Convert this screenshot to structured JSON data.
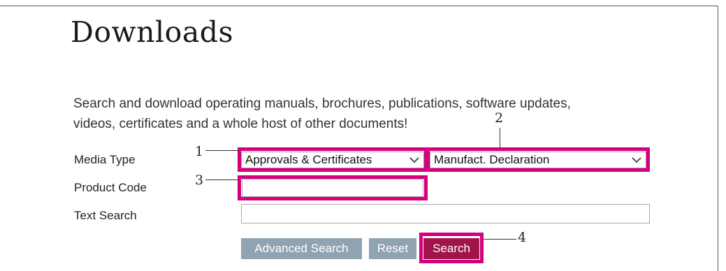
{
  "page": {
    "title": "Downloads"
  },
  "intro": {
    "line1": "Search and download operating manuals, brochures, publications, software updates,",
    "line2": "videos, certificates and a whole host of other documents!"
  },
  "form": {
    "media_type_label": "Media Type",
    "media_type_value": "Approvals & Certificates",
    "media_subtype_value": "Manufact. Declaration",
    "product_code_label": "Product Code",
    "product_code_value": "",
    "text_search_label": "Text Search",
    "text_search_value": ""
  },
  "buttons": {
    "advanced_search": "Advanced Search",
    "reset": "Reset",
    "search": "Search"
  },
  "callouts": {
    "c1": "1",
    "c2": "2",
    "c3": "3",
    "c4": "4"
  },
  "colors": {
    "highlight": "#d6007e",
    "search_button": "#a0144a",
    "grey_button": "#8fa3b0"
  },
  "icons": {
    "dropdown": "chevron-down-icon"
  }
}
